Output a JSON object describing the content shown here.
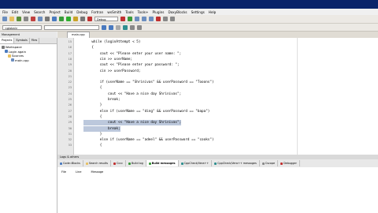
{
  "menu": [
    "File",
    "Edit",
    "View",
    "Search",
    "Project",
    "Build",
    "Debug",
    "Fortran",
    "wxSmith",
    "Tools",
    "Tools+",
    "Plugins",
    "DoxyBlocks",
    "Settings",
    "Help"
  ],
  "toolbar": {
    "target_label": "Debug",
    "global_label": "<global>"
  },
  "sidebar": {
    "title": "Management",
    "tabs": [
      "Projects",
      "Symbols",
      "Files"
    ],
    "tree": [
      {
        "label": "Workspace",
        "indent": 0
      },
      {
        "label": "Login again",
        "indent": 1
      },
      {
        "label": "Sources",
        "indent": 2
      },
      {
        "label": "main.cpp",
        "indent": 3
      }
    ]
  },
  "editor": {
    "tab_label": "main.cpp",
    "lines": [
      {
        "n": "15",
        "t": "    while (loginAttempt < 5)"
      },
      {
        "n": "16",
        "t": "    {"
      },
      {
        "n": "17",
        "t": "        cout << \"Please enter your user name: \";"
      },
      {
        "n": "18",
        "t": "        cin >> userName;"
      },
      {
        "n": "19",
        "t": "        cout << \"Please enter your password: \";"
      },
      {
        "n": "20",
        "t": "        cin >> userPassword;"
      },
      {
        "n": "21",
        "t": ""
      },
      {
        "n": "22",
        "t": "        if (userName == \"Shrinivas\" && userPassword == \"Tooons\")"
      },
      {
        "n": "23",
        "t": "        {"
      },
      {
        "n": "24",
        "t": "            cout << \"Have a nice day Shrinivas\";"
      },
      {
        "n": "25",
        "t": "            break;"
      },
      {
        "n": "26",
        "t": "        }"
      },
      {
        "n": "27",
        "t": "        else if (userName == \"ding\" && userPassword == \"bapa\")"
      },
      {
        "n": "28",
        "t": "        {"
      },
      {
        "n": "29",
        "t": "            cout << \"Have a nice day Shrinivas\";"
      },
      {
        "n": "30",
        "t": "            break;"
      },
      {
        "n": "31",
        "t": "        }"
      },
      {
        "n": "32",
        "t": "        else if (userName == \"adeel\" && userPassword == \"cooks\")"
      },
      {
        "n": "33",
        "t": "        {"
      }
    ],
    "selected_lines": [
      29,
      30
    ]
  },
  "logs": {
    "title": "Logs & others",
    "tabs": [
      "Code::Blocks",
      "Search results",
      "Cccc",
      "Build log",
      "Build messages",
      "CppCheck/Vera++",
      "CppCheck/Vera++ messages",
      "Cscope",
      "Debugger"
    ],
    "active_tab": "Build messages",
    "columns": [
      "File",
      "Line",
      "Message"
    ]
  }
}
